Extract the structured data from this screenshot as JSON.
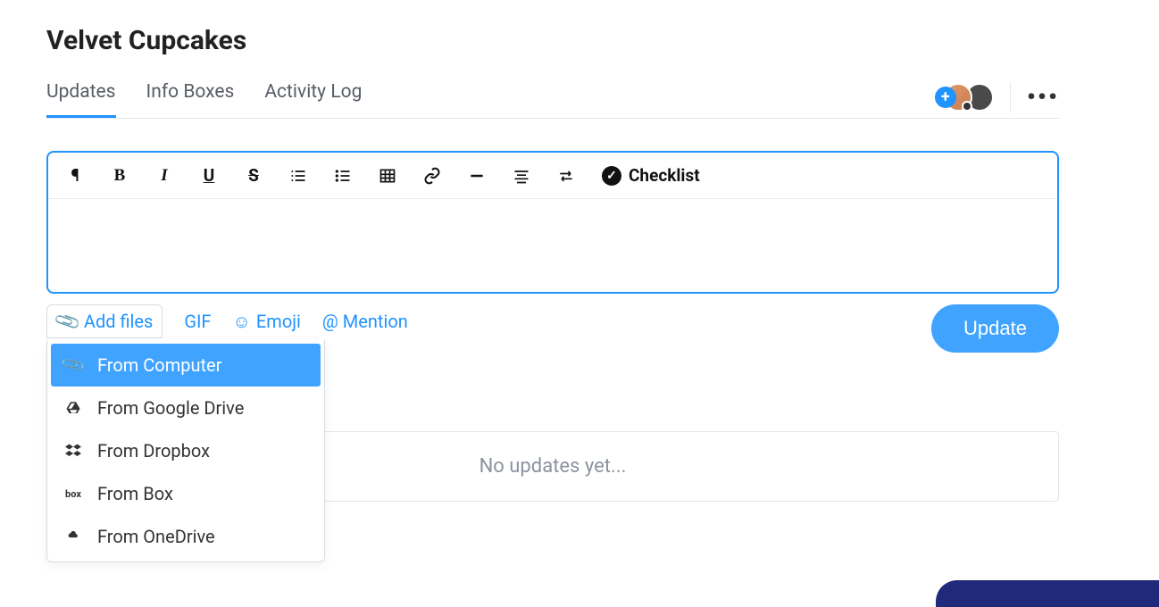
{
  "title": "Velvet Cupcakes",
  "tabs": {
    "updates": "Updates",
    "infoboxes": "Info Boxes",
    "activity": "Activity Log"
  },
  "toolbar": {
    "checklist_label": "Checklist"
  },
  "actions": {
    "add_files": "Add files",
    "gif": "GIF",
    "emoji": "Emoji",
    "mention": "@ Mention",
    "update": "Update"
  },
  "dropdown": {
    "computer": "From Computer",
    "gdrive": "From Google Drive",
    "dropbox": "From Dropbox",
    "box": "From Box",
    "onedrive": "From OneDrive"
  },
  "empty_state": "No updates yet...",
  "more": "•••"
}
